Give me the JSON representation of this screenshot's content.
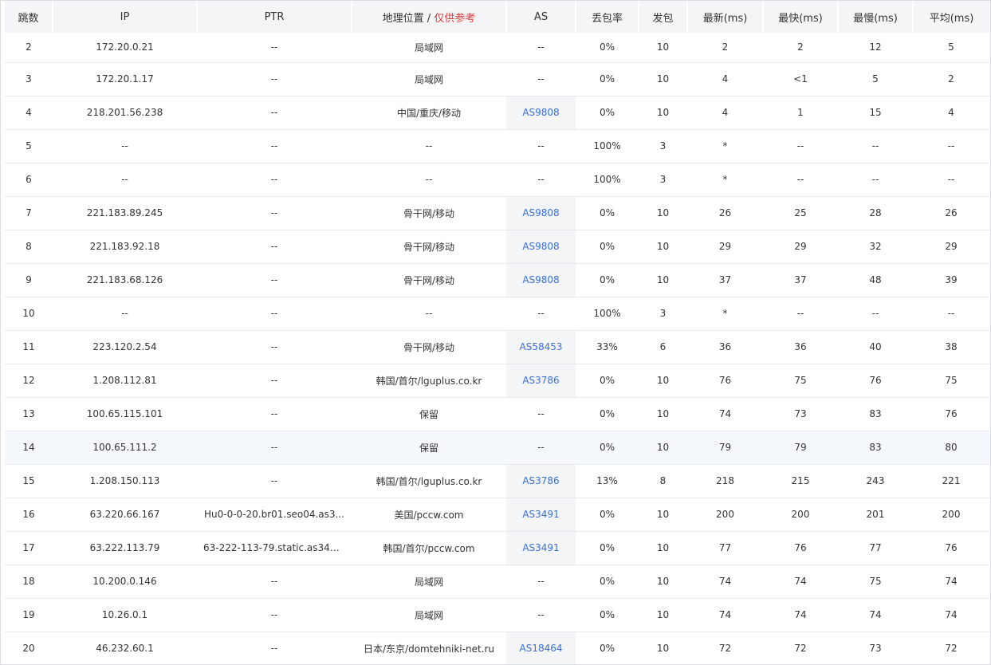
{
  "headers": {
    "hop": "跳数",
    "ip": "IP",
    "ptr": "PTR",
    "location": "地理位置",
    "location_sep": " / ",
    "location_note": "仅供参考",
    "as": "AS",
    "loss": "丢包率",
    "sent": "发包",
    "last": "最新(ms)",
    "best": "最快(ms)",
    "worst": "最慢(ms)",
    "avg": "平均(ms)"
  },
  "rows": [
    {
      "hop": "2",
      "ip": "172.20.0.21",
      "ptr": "--",
      "location": "局域网",
      "as": "--",
      "loss": "0%",
      "sent": "10",
      "last": "2",
      "best": "2",
      "worst": "12",
      "avg": "5"
    },
    {
      "hop": "3",
      "ip": "172.20.1.17",
      "ptr": "--",
      "location": "局域网",
      "as": "--",
      "loss": "0%",
      "sent": "10",
      "last": "4",
      "best": "<1",
      "worst": "5",
      "avg": "2"
    },
    {
      "hop": "4",
      "ip": "218.201.56.238",
      "ptr": "--",
      "location": "中国/重庆/移动",
      "as": "AS9808",
      "loss": "0%",
      "sent": "10",
      "last": "4",
      "best": "1",
      "worst": "15",
      "avg": "4"
    },
    {
      "hop": "5",
      "ip": "--",
      "ptr": "--",
      "location": "--",
      "as": "--",
      "loss": "100%",
      "sent": "3",
      "last": "*",
      "best": "--",
      "worst": "--",
      "avg": "--"
    },
    {
      "hop": "6",
      "ip": "--",
      "ptr": "--",
      "location": "--",
      "as": "--",
      "loss": "100%",
      "sent": "3",
      "last": "*",
      "best": "--",
      "worst": "--",
      "avg": "--"
    },
    {
      "hop": "7",
      "ip": "221.183.89.245",
      "ptr": "--",
      "location": "骨干网/移动",
      "as": "AS9808",
      "loss": "0%",
      "sent": "10",
      "last": "26",
      "best": "25",
      "worst": "28",
      "avg": "26"
    },
    {
      "hop": "8",
      "ip": "221.183.92.18",
      "ptr": "--",
      "location": "骨干网/移动",
      "as": "AS9808",
      "loss": "0%",
      "sent": "10",
      "last": "29",
      "best": "29",
      "worst": "32",
      "avg": "29"
    },
    {
      "hop": "9",
      "ip": "221.183.68.126",
      "ptr": "--",
      "location": "骨干网/移动",
      "as": "AS9808",
      "loss": "0%",
      "sent": "10",
      "last": "37",
      "best": "37",
      "worst": "48",
      "avg": "39"
    },
    {
      "hop": "10",
      "ip": "--",
      "ptr": "--",
      "location": "--",
      "as": "--",
      "loss": "100%",
      "sent": "3",
      "last": "*",
      "best": "--",
      "worst": "--",
      "avg": "--"
    },
    {
      "hop": "11",
      "ip": "223.120.2.54",
      "ptr": "--",
      "location": "骨干网/移动",
      "as": "AS58453",
      "loss": "33%",
      "sent": "6",
      "last": "36",
      "best": "36",
      "worst": "40",
      "avg": "38"
    },
    {
      "hop": "12",
      "ip": "1.208.112.81",
      "ptr": "--",
      "location": "韩国/首尔/lguplus.co.kr",
      "as": "AS3786",
      "loss": "0%",
      "sent": "10",
      "last": "76",
      "best": "75",
      "worst": "76",
      "avg": "75"
    },
    {
      "hop": "13",
      "ip": "100.65.115.101",
      "ptr": "--",
      "location": "保留",
      "as": "--",
      "loss": "0%",
      "sent": "10",
      "last": "74",
      "best": "73",
      "worst": "83",
      "avg": "76"
    },
    {
      "hop": "14",
      "ip": "100.65.111.2",
      "ptr": "--",
      "location": "保留",
      "as": "--",
      "loss": "0%",
      "sent": "10",
      "last": "79",
      "best": "79",
      "worst": "83",
      "avg": "80"
    },
    {
      "hop": "15",
      "ip": "1.208.150.113",
      "ptr": "--",
      "location": "韩国/首尔/lguplus.co.kr",
      "as": "AS3786",
      "loss": "13%",
      "sent": "8",
      "last": "218",
      "best": "215",
      "worst": "243",
      "avg": "221"
    },
    {
      "hop": "16",
      "ip": "63.220.66.167",
      "ptr": "Hu0-0-0-20.br01.seo04.as3...",
      "location": "美国/pccw.com",
      "as": "AS3491",
      "loss": "0%",
      "sent": "10",
      "last": "200",
      "best": "200",
      "worst": "201",
      "avg": "200"
    },
    {
      "hop": "17",
      "ip": "63.222.113.79",
      "ptr": "63-222-113-79.static.as3491...",
      "location": "韩国/首尔/pccw.com",
      "as": "AS3491",
      "loss": "0%",
      "sent": "10",
      "last": "77",
      "best": "76",
      "worst": "77",
      "avg": "76"
    },
    {
      "hop": "18",
      "ip": "10.200.0.146",
      "ptr": "--",
      "location": "局域网",
      "as": "--",
      "loss": "0%",
      "sent": "10",
      "last": "74",
      "best": "74",
      "worst": "75",
      "avg": "74"
    },
    {
      "hop": "19",
      "ip": "10.26.0.1",
      "ptr": "--",
      "location": "局域网",
      "as": "--",
      "loss": "0%",
      "sent": "10",
      "last": "74",
      "best": "74",
      "worst": "74",
      "avg": "74"
    },
    {
      "hop": "20",
      "ip": "46.232.60.1",
      "ptr": "--",
      "location": "日本/东京/domtehniki-net.ru",
      "as": "AS18464",
      "loss": "0%",
      "sent": "10",
      "last": "72",
      "best": "72",
      "worst": "73",
      "avg": "72"
    }
  ],
  "colors": {
    "link": "#3b6fd4",
    "note": "#e03a3a",
    "header_bg": "#f4f5f7",
    "hover_row_bg": "#f5f8fc"
  }
}
